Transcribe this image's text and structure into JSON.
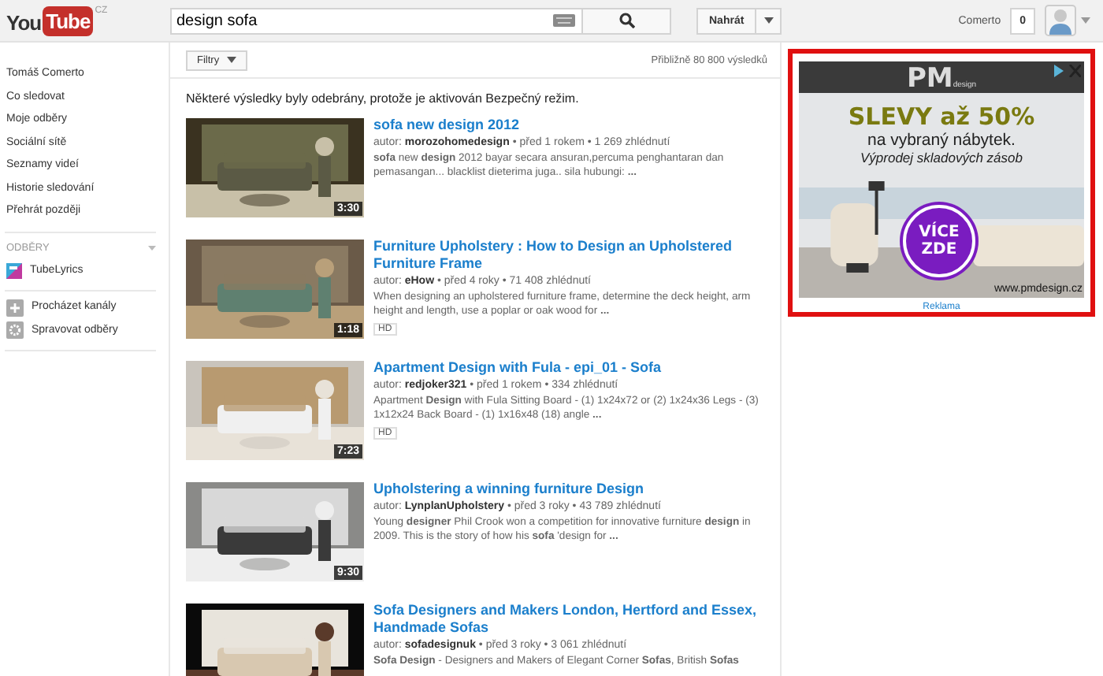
{
  "header": {
    "logo": {
      "you": "You",
      "tube": "Tube",
      "region": "CZ"
    },
    "search": {
      "value": "design sofa"
    },
    "upload_button": "Nahrát",
    "user_name": "Comerto",
    "notification_count": "0"
  },
  "sidebar": {
    "items": [
      {
        "label": "Tomáš Comerto"
      },
      {
        "label": "Co sledovat"
      },
      {
        "label": "Moje odběry"
      },
      {
        "label": "Sociální sítě"
      },
      {
        "label": "Seznamy videí"
      },
      {
        "label": "Historie sledování"
      },
      {
        "label": "Přehrát později"
      }
    ],
    "subscriptions_heading": "ODBĚRY",
    "subscriptions": [
      {
        "label": "TubeLyrics"
      }
    ],
    "actions": [
      {
        "label": "Procházet kanály",
        "kind": "add"
      },
      {
        "label": "Spravovat odběry",
        "kind": "settings"
      }
    ]
  },
  "filter_button": "Filtry",
  "result_count": "Přibližně 80 800 výsledků",
  "safety_notice": "Některé výsledky byly odebrány, protože je aktivován Bezpečný režim.",
  "results": [
    {
      "title": "sofa new design 2012",
      "meta": "autor: **morozohomedesign** • před 1 rokem • 1 269 zhlédnutí",
      "description": "**sofa** new **design** 2012 bayar secara ansuran,percuma penghantaran dan pemasangan... blacklist dieterima juga.. sila hubungi: **...**",
      "duration": "3:30"
    },
    {
      "title": "Furniture Upholstery : How to Design an Upholstered Furniture Frame",
      "meta": "autor: **eHow** • před 4 roky • 71 408 zhlédnutí",
      "description": "When designing an upholstered furniture frame, determine the deck height, arm height and length, use a poplar or oak wood for **...**",
      "duration": "1:18",
      "badge": "HD"
    },
    {
      "title": "Apartment Design with Fula - epi_01 - Sofa",
      "meta": "autor: **redjoker321** • před 1 rokem • 334 zhlédnutí",
      "description": "Apartment **Design** with Fula Sitting Board - (1) 1x24x72 or (2) 1x24x36 Legs - (3) 1x12x24 Back Board - (1) 1x16x48 (18) angle **...**",
      "duration": "7:23",
      "badge": "HD"
    },
    {
      "title": "Upholstering a winning furniture Design",
      "meta": "autor: **LynplanUpholstery** • před 3 roky • 43 789 zhlédnutí",
      "description": "Young **designer** Phil Crook won a competition for innovative furniture **design** in 2009. This is the story of how his **sofa** 'design for **...**",
      "duration": "9:30"
    },
    {
      "title": "Sofa Designers and Makers London, Hertford and Essex, Handmade Sofas",
      "meta": "autor: **sofadesignuk** • před 3 roky • 3 061 zhlédnutí",
      "description": "**Sofa Design** - Designers and Makers of Elegant Corner **Sofas**, British **Sofas**"
    }
  ],
  "ad": {
    "logo": "PM",
    "logo_sub": "design",
    "headline": "SLEVY až 50%",
    "line_1": "na vybraný nábytek.",
    "line_2": "Výprodej skladových zásob",
    "cta": "VÍCE ZDE",
    "url": "www.pmdesign.cz",
    "label": "Reklama"
  }
}
